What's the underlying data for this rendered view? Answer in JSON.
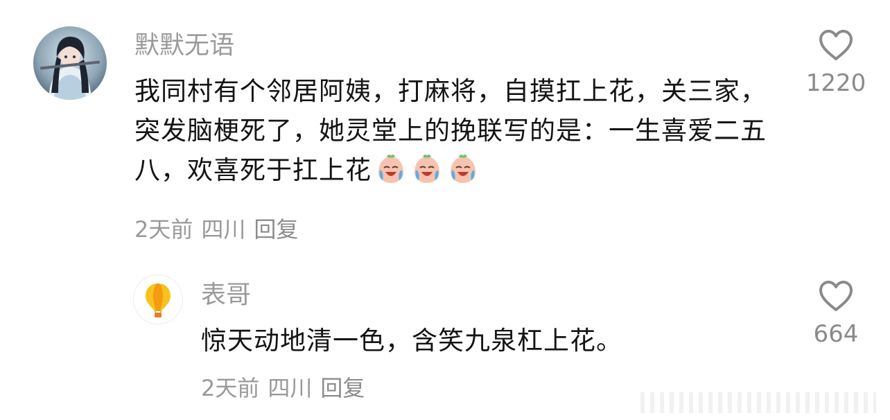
{
  "comments": [
    {
      "author": "默默无语",
      "avatar_icon": "anime-girl-avatar",
      "text": "我同村有个邻居阿姨，打麻将，自摸扛上花，关三家，突发脑梗死了，她灵堂上的挽联写的是：一生喜爱二五八，欢喜死于扛上花",
      "emojis": [
        "laugh-cry-emoji",
        "laugh-cry-emoji",
        "laugh-cry-emoji"
      ],
      "time": "2天前",
      "location": "四川",
      "reply_label": "回复",
      "likes": "1220",
      "like_icon": "heart-outline-icon"
    },
    {
      "author": "表哥",
      "avatar_icon": "hot-air-balloon-avatar",
      "text": "惊天动地清一色，含笑九泉杠上花。",
      "time": "2天前",
      "location": "四川",
      "reply_label": "回复",
      "likes": "664",
      "like_icon": "heart-outline-icon"
    }
  ],
  "colors": {
    "text_primary": "#141414",
    "text_secondary": "#9a9a9a",
    "icon_gray": "#8a8a8a",
    "background": "#ffffff"
  }
}
